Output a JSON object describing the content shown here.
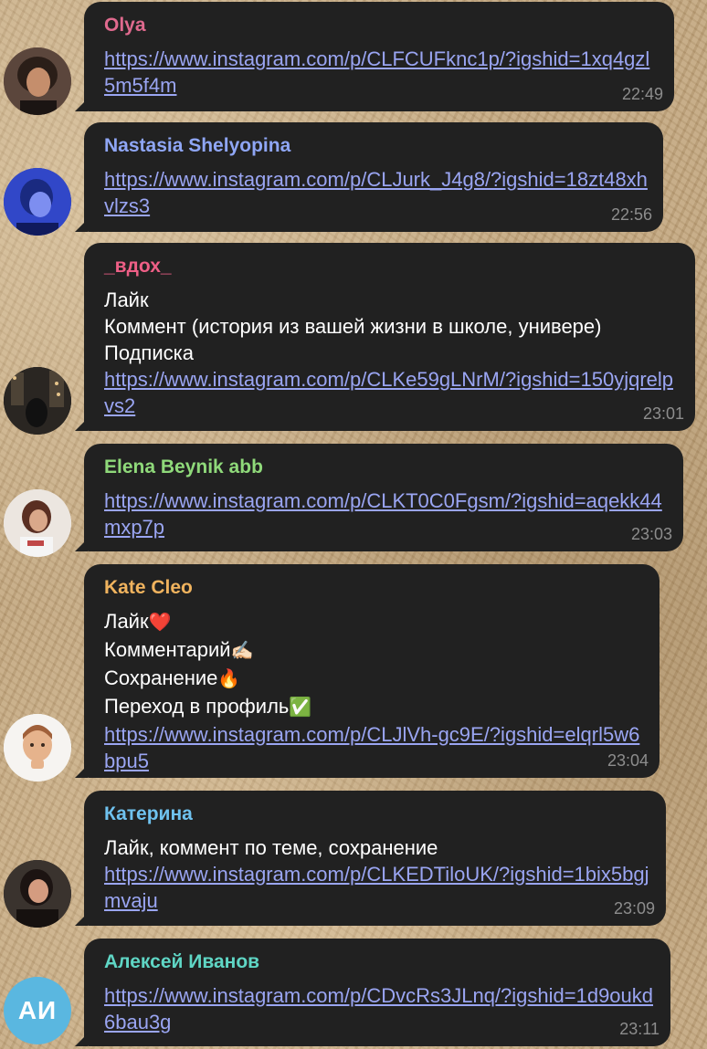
{
  "messages": [
    {
      "sender": "Olya",
      "sender_color": "#e06a8e",
      "lines": [],
      "link": "https://www.instagram.com/p/CLFCUFknc1p/?igshid=1xq4gzl5m5f4m",
      "time": "22:49"
    },
    {
      "sender": "Nastasia Shelyopina",
      "sender_color": "#8fa6f5",
      "lines": [],
      "link": "https://www.instagram.com/p/CLJurk_J4g8/?igshid=18zt48xhvlzs3",
      "time": "22:56"
    },
    {
      "sender": "_вдох_",
      "sender_color": "#ee5f86",
      "lines": [
        "Лайк",
        "Коммент (история из вашей жизни в школе, универе)",
        "Подписка"
      ],
      "link": "https://www.instagram.com/p/CLKe59gLNrM/?igshid=150yjqrelpvs2",
      "time": "23:01"
    },
    {
      "sender": "Elena Beynik abb",
      "sender_color": "#8fd97a",
      "lines": [],
      "link": "https://www.instagram.com/p/CLKT0C0Fgsm/?igshid=aqekk44mxp7p",
      "time": "23:03"
    },
    {
      "sender": "Kate Cleo",
      "sender_color": "#f0b35e",
      "lines": [
        "Лайк",
        "Комментарий",
        "Сохранение",
        "Переход в профиль"
      ],
      "emojis": [
        "❤️",
        "✍🏻",
        "🔥",
        "✅"
      ],
      "link": "https://www.instagram.com/p/CLJlVh-gc9E/?igshid=elqrl5w6bpu5",
      "time": "23:04"
    },
    {
      "sender": "Катерина",
      "sender_color": "#6fc2ef",
      "lines": [
        "Лайк, коммент по теме, сохранение"
      ],
      "link": "https://www.instagram.com/p/CLKEDTiloUK/?igshid=1bix5bgjmvaju",
      "time": "23:09"
    },
    {
      "sender": "Алексей Иванов",
      "sender_color": "#5fd6c5",
      "lines": [],
      "link": "https://www.instagram.com/p/CDvcRs3JLnq/?igshid=1d9oukd6bau3g",
      "time": "23:11",
      "avatar_initials": "АИ",
      "avatar_color": "#5ab7e0"
    }
  ]
}
